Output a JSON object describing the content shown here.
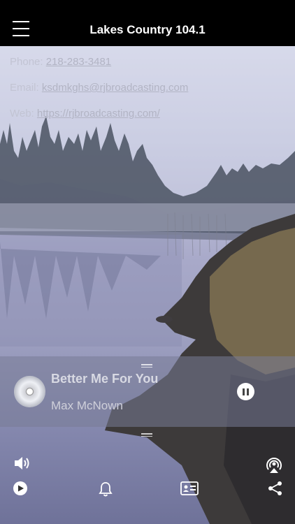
{
  "header": {
    "title": "Lakes Country 104.1"
  },
  "contact": {
    "phone_label": "Phone:",
    "phone_value": "218-283-3481",
    "email_label": "Email:",
    "email_value": "ksdmkghs@rjbroadcasting.com",
    "web_label": "Web:",
    "web_value": "https://rjbroadcasting.com/"
  },
  "player": {
    "song": "Better Me For You",
    "artist": "Max McNown"
  },
  "icons": {
    "menu": "hamburger-menu-icon",
    "album": "cd-disc-icon",
    "pause": "pause-icon",
    "volume": "speaker-volume-icon",
    "airplay": "airplay-broadcast-icon",
    "play": "play-icon",
    "alarm": "bell-icon",
    "contact": "contact-card-icon",
    "share": "share-icon"
  }
}
